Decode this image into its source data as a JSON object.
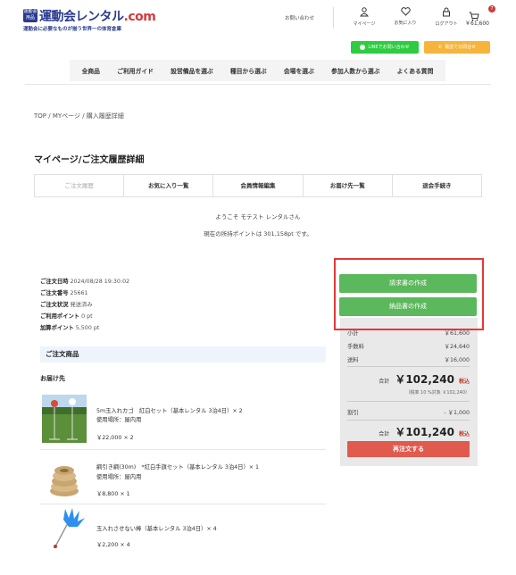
{
  "site": {
    "badge": "運動会用品",
    "name_main": "運動会レンタル",
    "name_dot": ".com",
    "tagline": "運動会に必要なものが揃う世界一の体育倉庫"
  },
  "header": {
    "contact": "お問い合わせ",
    "mypage": "マイページ",
    "favorites": "お気に入り",
    "logout": "ログアウト",
    "cart_count": "7",
    "cart_total": "￥61,600",
    "line_btn": "LINEでお問い合わせ",
    "phone_btn": "電話でお問合せ"
  },
  "nav": [
    "全商品",
    "ご利用ガイド",
    "設営備品を選ぶ",
    "種目から選ぶ",
    "会場を選ぶ",
    "参加人数から選ぶ",
    "よくある質問"
  ],
  "breadcrumb": "TOP / MYページ / 購入履歴詳細",
  "page_title": "マイページ/ご注文履歴詳細",
  "tabs": [
    "ご注文履歴",
    "お気に入り一覧",
    "会員情報編集",
    "お届け先一覧",
    "退会手続き"
  ],
  "welcome": "ようこそ モテスト レンタルさん",
  "points_msg": "現在の所持ポイントは 301,158pt です。",
  "order": {
    "date_label": "ご注文日時",
    "date": "2024/08/28 19:30:02",
    "no_label": "ご注文番号",
    "no": "25661",
    "status_label": "ご注文状況",
    "status": "発送済み",
    "used_label": "ご利用ポイント",
    "used": "0 pt",
    "added_label": "加算ポイント",
    "added": "5,500 pt"
  },
  "products_heading": "ご注文商品",
  "ship_label": "お届け先",
  "items": [
    {
      "name": "5m玉入れカゴ　紅白セット（基本レンタル 3泊4日）× 2",
      "place": "使用場所：屋内用",
      "price": "￥22,000 × 2"
    },
    {
      "name": "綱引き綱(30m)　*紅白手旗セット（基本レンタル 3泊4日）× 1",
      "place": "使用場所：屋内用",
      "price": "￥8,800 × 1"
    },
    {
      "name": "玉入れさせない棒（基本レンタル 3泊4日）× 4",
      "place": "",
      "price": "￥2,200 × 4"
    }
  ],
  "sidebar": {
    "invoice_btn": "請求書の作成",
    "delivery_btn": "納品書の作成",
    "subtotal_label": "小計",
    "subtotal": "￥61,600",
    "fee_label": "手数料",
    "fee": "￥24,640",
    "shipping_label": "送料",
    "shipping": "￥16,000",
    "total_label": "合計",
    "total": "￥102,240",
    "tax_in": "税込",
    "tax_breakdown": "（税率 10 %対象 ￥102,240）",
    "discount_label": "割引",
    "discount": "- ￥1,000",
    "final_label": "合計",
    "final": "￥101,240",
    "final_tax": "税込",
    "reorder_btn": "再注文する"
  },
  "colors": {
    "brand": "#2a3b8f",
    "accent_red": "#d23a3a",
    "green_btn": "#5cb85c",
    "reorder": "#e05a4e",
    "highlight": "#e53935"
  }
}
